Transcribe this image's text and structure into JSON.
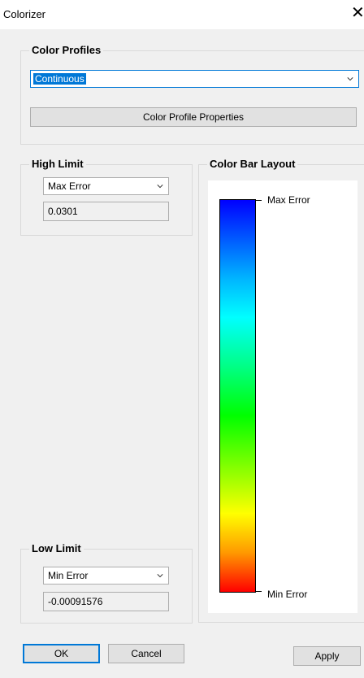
{
  "window": {
    "title": "Colorizer",
    "close_glyph": "✕"
  },
  "color_profiles": {
    "legend": "Color Profiles",
    "selected": "Continuous",
    "properties_button": "Color Profile Properties"
  },
  "high_limit": {
    "legend": "High Limit",
    "mode": "Max Error",
    "value": "0.0301"
  },
  "low_limit": {
    "legend": "Low Limit",
    "mode": "Min Error",
    "value": "-0.00091576"
  },
  "color_bar": {
    "legend": "Color Bar Layout",
    "top_label": "Max Error",
    "bottom_label": "Min Error",
    "gradient_colors": [
      "#0000ff",
      "#00b4ff",
      "#00ffff",
      "#00ff80",
      "#00ff00",
      "#aaff00",
      "#ffff00",
      "#ff9900",
      "#ff0000"
    ]
  },
  "footer": {
    "ok": "OK",
    "cancel": "Cancel",
    "apply": "Apply"
  },
  "colors": {
    "accent": "#0078d7",
    "dialog_bg": "#f0f0f0"
  }
}
